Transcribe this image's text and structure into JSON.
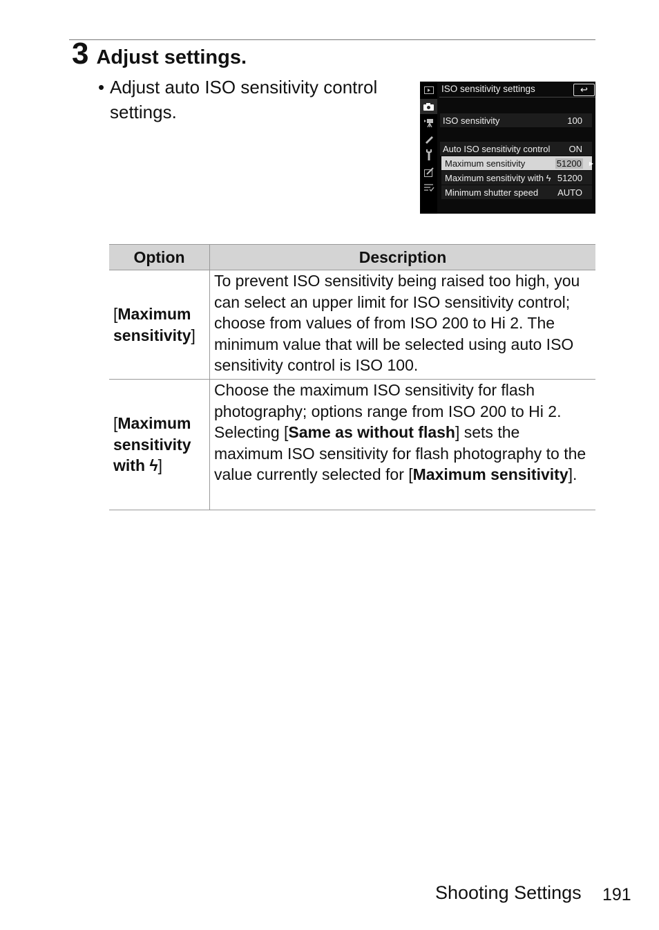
{
  "step": {
    "number": "3",
    "title": "Adjust settings."
  },
  "bullet": {
    "marker": "•",
    "text": "Adjust auto ISO sensitivity control settings."
  },
  "camera_screen": {
    "title": "ISO sensitivity settings",
    "back_icon": "↩",
    "sidebar_icons": [
      "playback-icon",
      "photo-shooting-icon",
      "movie-recording-icon",
      "custom-settings-icon",
      "setup-icon",
      "retouch-icon",
      "my-menu-icon"
    ],
    "rows": [
      {
        "label": "ISO sensitivity",
        "value": "100"
      },
      {
        "label": "Auto ISO sensitivity control",
        "value": "ON"
      },
      {
        "label": "Maximum sensitivity",
        "value": "51200",
        "selected": true
      },
      {
        "label": "Maximum sensitivity with ϟ",
        "value": "51200"
      },
      {
        "label": "Minimum shutter speed",
        "value": "AUTO"
      }
    ]
  },
  "table": {
    "headers": [
      "Option",
      "Description"
    ],
    "rows": [
      {
        "option_prefix": "[",
        "option_bold": "Maximum sensitivity",
        "option_suffix": "]",
        "description": "To prevent ISO sensitivity being raised too high, you can select an upper limit for ISO sensitivity control; choose from values of from ISO 200 to Hi 2. The minimum value that will be selected using auto ISO sensitivity control is ISO 100."
      },
      {
        "option_prefix": "[",
        "option_bold": "Maximum sensitivity with ϟ",
        "option_suffix": "]",
        "description_1": "Choose the maximum ISO sensitivity for flash photography; options range from ISO 200 to Hi 2. Selecting [",
        "description_bold_1": "Same as without flash",
        "description_2": "] sets the maximum ISO sensitivity for flash photography to the value currently selected for [",
        "description_bold_2": "Maximum sensitivity",
        "description_3": "]."
      }
    ]
  },
  "footer": {
    "section": "Shooting Settings",
    "page": "191"
  }
}
